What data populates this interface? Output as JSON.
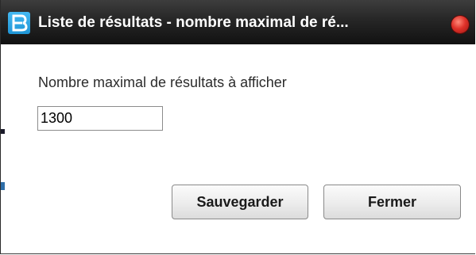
{
  "window": {
    "title": "Liste de résultats - nombre maximal de ré...",
    "app_icon": "b-logo-icon",
    "close_icon": "red-circle-close-icon"
  },
  "form": {
    "label": "Nombre maximal de résultats à afficher",
    "value": "1300"
  },
  "buttons": {
    "save_label": "Sauvegarder",
    "close_label": "Fermer"
  },
  "colors": {
    "titlebar": "#1c1c1c",
    "app_icon": "#2aa3e6",
    "close_button": "#e0322a"
  }
}
